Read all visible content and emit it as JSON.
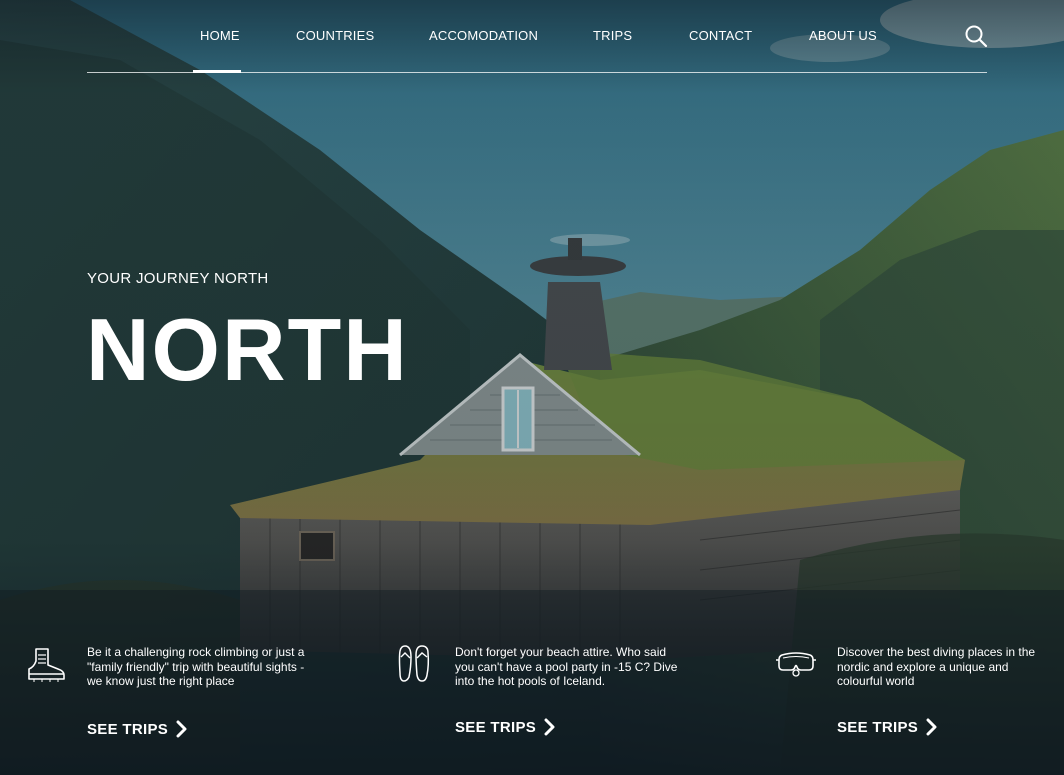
{
  "nav": {
    "items": [
      {
        "label": "HOME"
      },
      {
        "label": "COUNTRIES"
      },
      {
        "label": "ACCOMODATION"
      },
      {
        "label": "TRIPS"
      },
      {
        "label": "CONTACT"
      },
      {
        "label": "ABOUT US"
      }
    ],
    "active_item": "HOME"
  },
  "hero": {
    "eyebrow": "YOUR JOURNEY NORTH",
    "title": "NORTH"
  },
  "features": [
    {
      "icon": "hiking-boot-icon",
      "text": "Be it a challenging rock climbing or just a \"family friendly\" trip with beautiful sights - we know just the right place",
      "cta": "SEE TRIPS"
    },
    {
      "icon": "flip-flops-icon",
      "text": "Don't forget your beach attire. Who said you can't have a pool party in -15 C? Dive into the hot pools of Iceland.",
      "cta": "SEE TRIPS"
    },
    {
      "icon": "diving-mask-icon",
      "text": "Discover the best diving places in the nordic and explore a unique and colourful world",
      "cta": "SEE TRIPS"
    }
  ],
  "colors": {
    "sky": "#3f7f93",
    "mountain": "#2f4a43",
    "grass": "#5c7a3a",
    "cabin": "#5a5650",
    "overlay": "#16212b",
    "text": "#ffffff"
  }
}
